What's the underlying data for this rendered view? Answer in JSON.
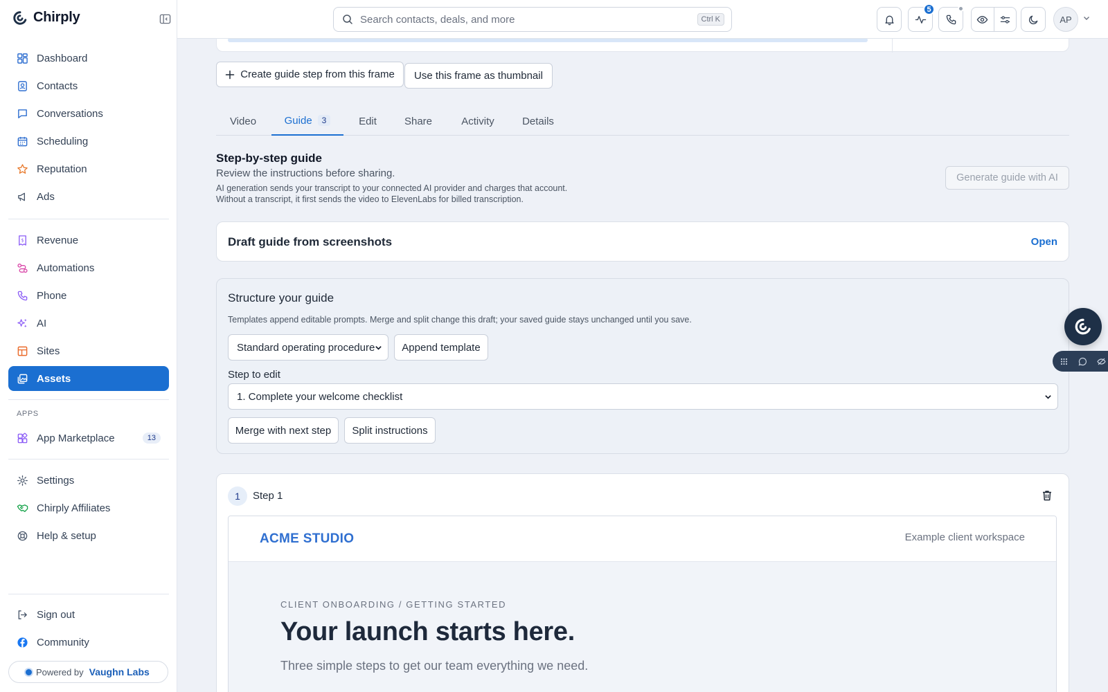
{
  "app": {
    "name": "Chirply"
  },
  "sidebar": {
    "items": [
      {
        "label": "Dashboard"
      },
      {
        "label": "Contacts"
      },
      {
        "label": "Conversations"
      },
      {
        "label": "Scheduling"
      },
      {
        "label": "Reputation"
      },
      {
        "label": "Ads"
      },
      {
        "label": "Revenue"
      },
      {
        "label": "Automations"
      },
      {
        "label": "Phone"
      },
      {
        "label": "AI"
      },
      {
        "label": "Sites"
      },
      {
        "label": "Assets"
      }
    ],
    "apps_label": "APPS",
    "app_marketplace": {
      "label": "App Marketplace",
      "count": "13"
    },
    "footer_items": [
      {
        "label": "Settings"
      },
      {
        "label": "Chirply Affiliates"
      },
      {
        "label": "Help & setup"
      }
    ],
    "bottom_items": [
      {
        "label": "Sign out"
      },
      {
        "label": "Community"
      }
    ],
    "powered": {
      "label": "Powered by",
      "brand": "Vaughn Labs"
    }
  },
  "topbar": {
    "search_placeholder": "Search contacts, deals, and more",
    "shortcut": "Ctrl K",
    "activity_badge": "5",
    "avatar_initials": "AP"
  },
  "actions": {
    "create_step": "Create guide step from this frame",
    "use_thumbnail": "Use this frame as thumbnail"
  },
  "tabs": [
    {
      "label": "Video"
    },
    {
      "label": "Guide",
      "count": "3"
    },
    {
      "label": "Edit"
    },
    {
      "label": "Share"
    },
    {
      "label": "Activity"
    },
    {
      "label": "Details"
    }
  ],
  "guide": {
    "title": "Step-by-step guide",
    "subtitle": "Review the instructions before sharing.",
    "note": "AI generation sends your transcript to your connected AI provider and charges that account. Without a transcript, it first sends the video to ElevenLabs for billed transcription.",
    "generate_button": "Generate guide with AI"
  },
  "draft": {
    "title": "Draft guide from screenshots",
    "open": "Open"
  },
  "structure": {
    "title": "Structure your guide",
    "description": "Templates append editable prompts. Merge and split change this draft; your saved guide stays unchanged until you save.",
    "template_select": "Standard operating procedure",
    "append_button": "Append template",
    "step_label": "Step to edit",
    "step_select": "1. Complete your welcome checklist",
    "merge_button": "Merge with next step",
    "split_button": "Split instructions"
  },
  "step": {
    "number": "1",
    "label": "Step 1",
    "preview": {
      "brand": "ACME STUDIO",
      "workspace": "Example client workspace",
      "eyebrow": "CLIENT ONBOARDING / GETTING STARTED",
      "headline": "Your launch starts here.",
      "sub": "Three simple steps to get our team everything we need."
    }
  },
  "colors": {
    "accent": "#1b6fd1",
    "fab": "#1e3047"
  }
}
